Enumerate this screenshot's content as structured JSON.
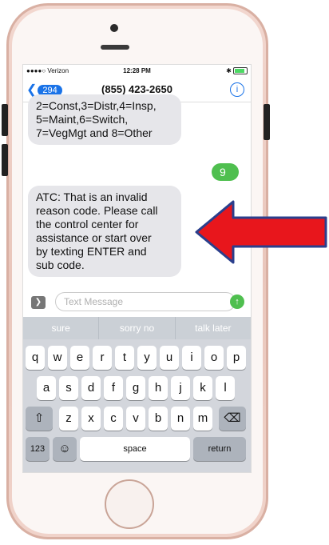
{
  "status_bar": {
    "carrier": "●●●●○ Verizon",
    "time": "12:28 PM",
    "right": "✱"
  },
  "nav": {
    "back_count": "294",
    "title": "(855) 423-2650",
    "info": "i"
  },
  "messages": [
    {
      "from": "them",
      "text": "2=Const,3=Distr,4=Insp,\n5=Maint,6=Switch,\n7=VegMgt and 8=Other"
    },
    {
      "from": "me",
      "text": "9"
    },
    {
      "from": "them",
      "text": "ATC: That is an invalid\nreason code. Please call\nthe control center for\nassistance or start over\nby texting ENTER and\nsub code."
    }
  ],
  "input": {
    "placeholder": "Text Message"
  },
  "suggestions": [
    "sure",
    "sorry no",
    "talk later"
  ],
  "keyboard": {
    "row1": [
      "q",
      "w",
      "e",
      "r",
      "t",
      "y",
      "u",
      "i",
      "o",
      "p"
    ],
    "row2": [
      "a",
      "s",
      "d",
      "f",
      "g",
      "h",
      "j",
      "k",
      "l"
    ],
    "row3": [
      "z",
      "x",
      "c",
      "v",
      "b",
      "n",
      "m"
    ],
    "num_key": "123",
    "emoji_key": "☺",
    "space_key": "space",
    "return_key": "return",
    "shift_key": "⇧",
    "delete_key": "⌫"
  },
  "colors": {
    "arrow_fill": "#e8161c",
    "arrow_outline": "#2b3f8c",
    "sent_bubble": "#4fbf4f",
    "accent": "#1a73e8"
  }
}
